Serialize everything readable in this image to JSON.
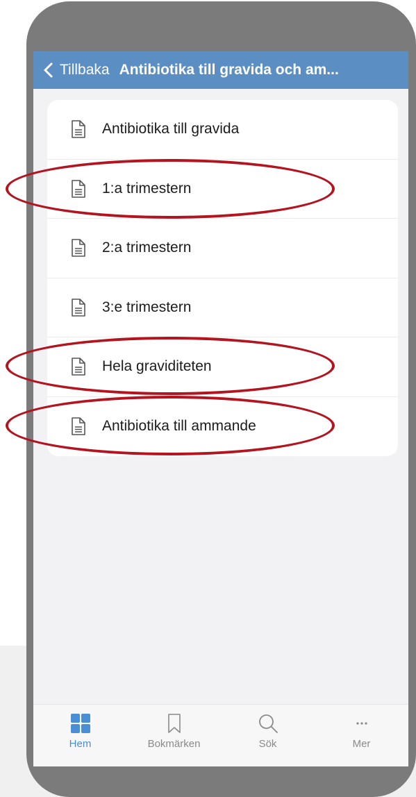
{
  "navbar": {
    "back_label": "Tillbaka",
    "title": "Antibiotika till gravida och am..."
  },
  "list": {
    "items": [
      {
        "label": "Antibiotika till gravida",
        "icon": "document-icon",
        "highlighted": false
      },
      {
        "label": "1:a trimestern",
        "icon": "document-icon",
        "highlighted": true
      },
      {
        "label": "2:a trimestern",
        "icon": "document-icon",
        "highlighted": false
      },
      {
        "label": "3:e trimestern",
        "icon": "document-icon",
        "highlighted": false
      },
      {
        "label": "Hela graviditeten",
        "icon": "document-icon",
        "highlighted": true
      },
      {
        "label": "Antibiotika till ammande",
        "icon": "document-icon",
        "highlighted": true
      }
    ]
  },
  "tabbar": {
    "tabs": [
      {
        "label": "Hem",
        "icon": "home-grid-icon",
        "active": true
      },
      {
        "label": "Bokmärken",
        "icon": "bookmark-icon",
        "active": false
      },
      {
        "label": "Sök",
        "icon": "search-icon",
        "active": false
      },
      {
        "label": "Mer",
        "icon": "more-icon",
        "active": false
      }
    ]
  },
  "colors": {
    "navbar_bg": "#5b8fc4",
    "active_tab": "#4a8fd6",
    "annotation": "#b3141f",
    "phone_frame": "#7b7b7b"
  }
}
